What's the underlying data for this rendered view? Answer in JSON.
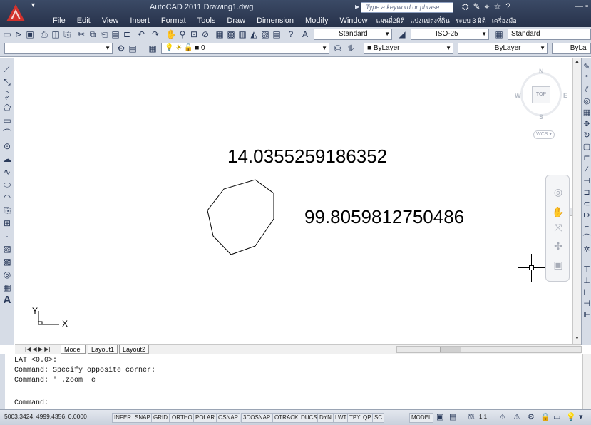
{
  "app": {
    "title": "AutoCAD 2011  Drawing1.dwg",
    "search_placeholder": "Type a keyword or phrase"
  },
  "menu": [
    "File",
    "Edit",
    "View",
    "Insert",
    "Format",
    "Tools",
    "Draw",
    "Dimension",
    "Modify",
    "Window",
    "แผนที่2มิติ",
    "แบ่งแปลงที่ดิน",
    "ระบบ 3 มิติ",
    "เครื่องมือ"
  ],
  "toolbar": {
    "text_style": "Standard",
    "dim_style": "ISO-25",
    "table_style": "Standard",
    "layer": "0",
    "color": "ByLayer",
    "linetype": "ByLayer",
    "lineweight": "ByLa"
  },
  "drawing": {
    "text1": "14.0355259186352",
    "text2": "99.8059812750486",
    "ucs_x": "X",
    "ucs_y": "Y"
  },
  "viewcube": {
    "north": "N",
    "south": "S",
    "east": "E",
    "west": "W",
    "top": "TOP",
    "wcs": "WCS"
  },
  "layout_tabs": [
    "Model",
    "Layout1",
    "Layout2"
  ],
  "command": {
    "lines": [
      "LAT <0.0>:",
      "Command: Specify opposite corner:",
      "Command: '_.zoom _e"
    ],
    "prompt": "Command:"
  },
  "status": {
    "coords": "5003.3424, 4999.4356, 0.0000",
    "toggles": [
      "INFER",
      "SNAP",
      "GRID",
      "ORTHO",
      "POLAR",
      "OSNAP",
      "3DOSNAP",
      "OTRACK",
      "DUCS",
      "DYN",
      "LWT",
      "TPY",
      "QP",
      "SC"
    ],
    "model": "MODEL",
    "scale": "1:1"
  },
  "colors": {
    "title_bg": "#2f3b55",
    "toolbar_bg": "#d6dce6",
    "drawing_bg": "#ffffff",
    "app_button_red": "#d2322d"
  }
}
